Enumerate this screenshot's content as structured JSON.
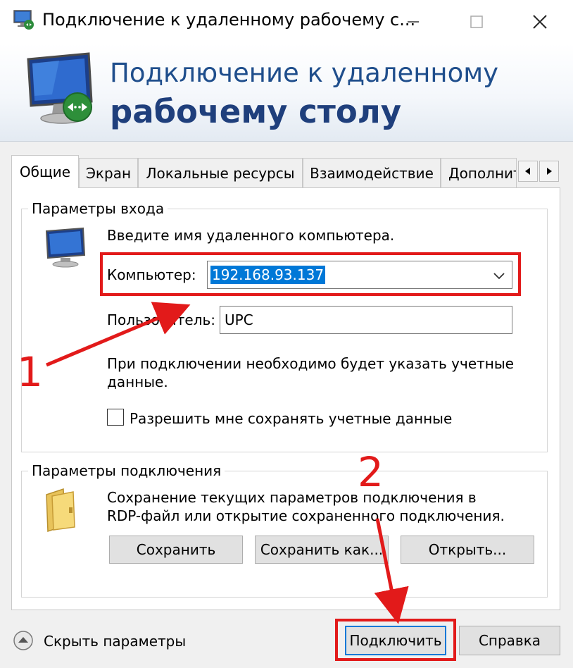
{
  "window": {
    "title": "Подключение к удаленному рабочему с...",
    "controls": [
      "minimize",
      "maximize",
      "close"
    ]
  },
  "banner": {
    "line1": "Подключение к удаленному",
    "line2": "рабочему столу"
  },
  "tabs": [
    {
      "label": "Общие",
      "selected": true
    },
    {
      "label": "Экран",
      "selected": false
    },
    {
      "label": "Локальные ресурсы",
      "selected": false
    },
    {
      "label": "Взаимодействие",
      "selected": false
    },
    {
      "label": "Дополнит",
      "selected": false
    }
  ],
  "login_group": {
    "title": "Параметры входа",
    "instruction": "Введите имя удаленного компьютера.",
    "computer_label": "Компьютер:",
    "computer_value": "192.168.93.137",
    "user_label": "Пользователь:",
    "user_value": "UPC",
    "note_line1": "При подключении необходимо будет указать учетные",
    "note_line2": "данные.",
    "save_creds_label": "Разрешить мне сохранять учетные данные",
    "save_creds_checked": false
  },
  "connection_group": {
    "title": "Параметры подключения",
    "text_line1": "Сохранение текущих параметров подключения в",
    "text_line2": "RDP-файл или открытие сохраненного подключения.",
    "save_label": "Сохранить",
    "saveas_label": "Сохранить как...",
    "open_label": "Открыть..."
  },
  "footer": {
    "hide_options_label": "Скрыть параметры",
    "connect_label": "Подключить",
    "help_label": "Справка"
  },
  "annotations": {
    "step1": "1",
    "step2": "2",
    "color": "#e21a1a"
  },
  "colors": {
    "banner_text": "#1f4e8c",
    "selection": "#0078d7"
  }
}
